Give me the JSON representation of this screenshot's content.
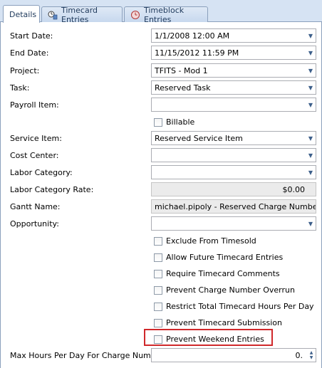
{
  "tabs": [
    {
      "label": "Details",
      "icon": "none"
    },
    {
      "label": "Timecard Entries",
      "icon": "timecard-icon"
    },
    {
      "label": "Timeblock Entries",
      "icon": "timeblock-icon"
    }
  ],
  "form": {
    "start_date": {
      "label": "Start Date:",
      "value": "1/1/2008 12:00 AM"
    },
    "end_date": {
      "label": "End Date:",
      "value": "11/15/2012 11:59 PM"
    },
    "project": {
      "label": "Project:",
      "value": "TFITS - Mod 1"
    },
    "task": {
      "label": "Task:",
      "value": "Reserved Task"
    },
    "payroll_item": {
      "label": "Payroll Item:",
      "value": ""
    },
    "billable": {
      "label": "Billable",
      "checked": false
    },
    "service_item": {
      "label": "Service Item:",
      "value": "Reserved Service Item"
    },
    "cost_center": {
      "label": "Cost Center:",
      "value": ""
    },
    "labor_category": {
      "label": "Labor Category:",
      "value": ""
    },
    "labor_category_rate": {
      "label": "Labor Category Rate:",
      "value": "$0.00"
    },
    "gantt_name": {
      "label": "Gantt Name:",
      "value": "michael.pipoly - Reserved Charge Number"
    },
    "opportunity": {
      "label": "Opportunity:",
      "value": ""
    },
    "checkboxes": [
      {
        "label": "Exclude From Timesold",
        "checked": false
      },
      {
        "label": "Allow Future Timecard Entries",
        "checked": false
      },
      {
        "label": "Require Timecard Comments",
        "checked": false
      },
      {
        "label": "Prevent Charge Number Overrun",
        "checked": false
      },
      {
        "label": "Restrict Total Timecard Hours Per Day",
        "checked": false
      },
      {
        "label": "Prevent Timecard Submission",
        "checked": false
      },
      {
        "label": "Prevent Weekend Entries",
        "checked": false
      }
    ],
    "max_hours": {
      "label": "Max Hours Per Day For Charge Number:",
      "value": "0."
    }
  },
  "colors": {
    "highlight": "#d0282b",
    "tab_bg": "#d6e3f3"
  }
}
